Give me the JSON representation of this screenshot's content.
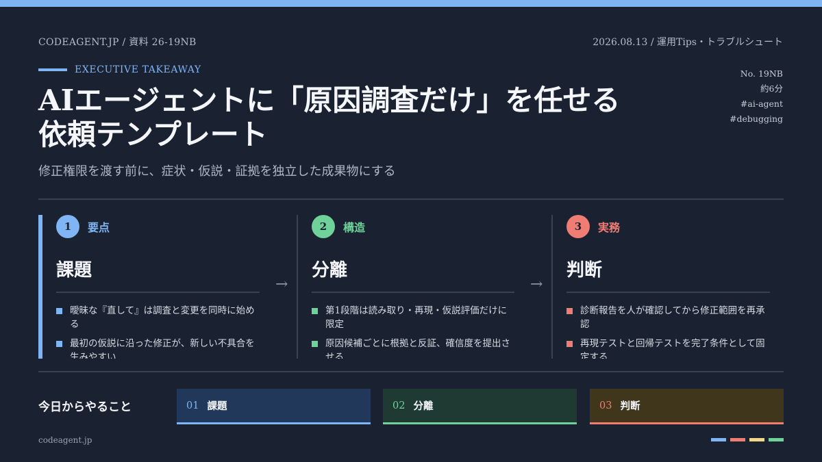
{
  "colors": {
    "accent_blue": "#7fb4f5",
    "accent_green": "#6fd29a",
    "accent_red": "#f07d74",
    "accent_yellow": "#f2d788",
    "bg": "#1a2130"
  },
  "header": {
    "left": "CODEAGENT.JP / 資料 26-19NB",
    "right": "2026.08.13 / 運用Tips・トラブルシュート"
  },
  "kicker": "EXECUTIVE TAKEAWAY",
  "title_line1": "AIエージェントに「原因調査だけ」を任せる",
  "title_line2": "依頼テンプレート",
  "subtitle": "修正権限を渡す前に、症状・仮説・証拠を独立した成果物にする",
  "side_meta": {
    "number": "No. 19NB",
    "read_time": "約6分",
    "tag1": "#ai-agent",
    "tag2": "#debugging"
  },
  "columns": [
    {
      "num": "1",
      "category": "要点",
      "title": "課題",
      "bullets": [
        "曖昧な『直して』は調査と変更を同時に始める",
        "最初の仮説に沿った修正が、新しい不具合を生みやすい"
      ]
    },
    {
      "num": "2",
      "category": "構造",
      "title": "分離",
      "bullets": [
        "第1段階は読み取り・再現・仮説評価だけに限定",
        "原因候補ごとに根拠と反証、確信度を提出させる"
      ]
    },
    {
      "num": "3",
      "category": "実務",
      "title": "判断",
      "bullets": [
        "診断報告を人が確認してから修正範囲を再承認",
        "再現テストと回帰テストを完了条件として固定する"
      ]
    }
  ],
  "arrow": "→",
  "todo": {
    "label": "今日からやること",
    "items": [
      {
        "num": "01",
        "label": "課題"
      },
      {
        "num": "02",
        "label": "分離"
      },
      {
        "num": "03",
        "label": "判断"
      }
    ]
  },
  "footer": "codeagent.jp"
}
